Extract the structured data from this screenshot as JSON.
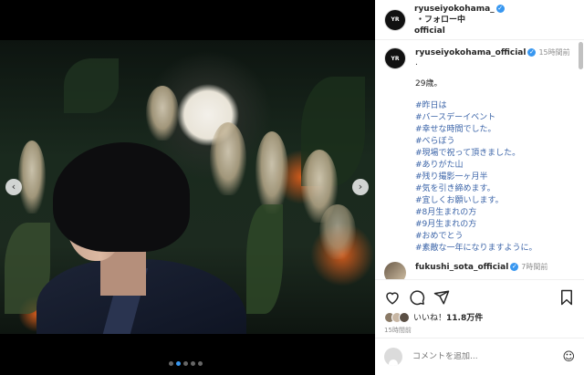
{
  "header": {
    "username": "ryuseiyokohama_",
    "username_line2": "official",
    "follow_status": "・フォロー中",
    "avatar_text": "YR"
  },
  "caption": {
    "username": "ryuseiyokohama_official",
    "time": "15時間前",
    "dot": ".",
    "age_line": "29歳。",
    "hashtags": [
      "#昨日は",
      "#バースデーイベント",
      "#幸せな時間でした。",
      "#べらぼう",
      "#現場で祝って頂きました。",
      "#ありがた山",
      "#残り撮影一ヶ月半",
      "#気を引き締めます。",
      "#宜しくお願いします。",
      "#8月生まれの方",
      "#9月生まれの方",
      "#おめでとう",
      "#素敵な一年になりますように。"
    ]
  },
  "comment2": {
    "username": "fukushi_sota_official",
    "time": "7時間前"
  },
  "likes": {
    "prefix": "いいね！",
    "count": "11.8万件"
  },
  "post_time": "15時間前",
  "comment_input": {
    "placeholder": "コメントを追加..."
  },
  "icons": {
    "like": "heart-icon",
    "comment": "comment-icon",
    "share": "share-icon",
    "save": "bookmark-icon",
    "emoji": "emoji-icon",
    "prev": "chevron-left-icon",
    "next": "chevron-right-icon"
  },
  "colors": {
    "accent": "#3897f0",
    "hashtag": "#3b64a8"
  },
  "carousel": {
    "total_slides": 5,
    "active_index": 1
  }
}
